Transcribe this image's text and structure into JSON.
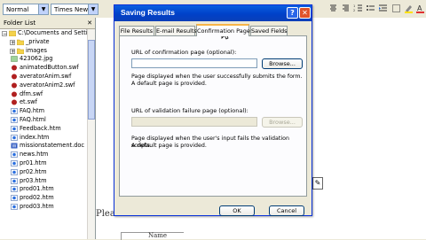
{
  "toolbar": {
    "style_value": "Normal",
    "font_value": "Times New Roman"
  },
  "folder_list": {
    "header": "Folder List",
    "items": [
      {
        "label": "C:\\Documents and Setting",
        "type": "root"
      },
      {
        "label": "_private",
        "type": "folder"
      },
      {
        "label": "images",
        "type": "folder"
      },
      {
        "label": "423062.jpg",
        "type": "image"
      },
      {
        "label": "animatedButton.swf",
        "type": "swf"
      },
      {
        "label": "averatorAnim.swf",
        "type": "swf"
      },
      {
        "label": "averatorAnim2.swf",
        "type": "swf"
      },
      {
        "label": "dfm.swf",
        "type": "swf"
      },
      {
        "label": "et.swf",
        "type": "swf"
      },
      {
        "label": "FAQ.htm",
        "type": "html"
      },
      {
        "label": "FAQ.html",
        "type": "html"
      },
      {
        "label": "Feedback.htm",
        "type": "html"
      },
      {
        "label": "index.htm",
        "type": "html"
      },
      {
        "label": "missionstatement.doc",
        "type": "doc"
      },
      {
        "label": "news.htm",
        "type": "html"
      },
      {
        "label": "pr01.htm",
        "type": "html"
      },
      {
        "label": "pr02.htm",
        "type": "html"
      },
      {
        "label": "pr03.htm",
        "type": "html"
      },
      {
        "label": "prod01.htm",
        "type": "html"
      },
      {
        "label": "prod02.htm",
        "type": "html"
      },
      {
        "label": "prod03.htm",
        "type": "html"
      }
    ]
  },
  "background_text": {
    "please": "Plea",
    "name": "Name"
  },
  "dialog": {
    "title": "Saving Results",
    "tabs": [
      "File Results",
      "E-mail Results",
      "Confirmation Page",
      "Saved Fields"
    ],
    "active_tab": "Confirmation Page",
    "confirmation_label": "URL of confirmation page (optional):",
    "confirmation_value": "",
    "browse_label": "Browse...",
    "confirmation_desc_1": "Page displayed when the user successfully submits the form.",
    "confirmation_desc_2": "A default page is provided.",
    "validation_label": "URL of validation failure page (optional):",
    "validation_value": "",
    "browse_disabled_label": "Browse...",
    "validation_desc_1": "Page displayed when the user's input fails the validation scripts.",
    "validation_desc_2": "A default page is provided.",
    "ok_label": "OK",
    "cancel_label": "Cancel"
  },
  "colors": {
    "titlebar": "#0041c8",
    "close_button": "#e0532a",
    "active_tab_accent": "#f8b548"
  }
}
